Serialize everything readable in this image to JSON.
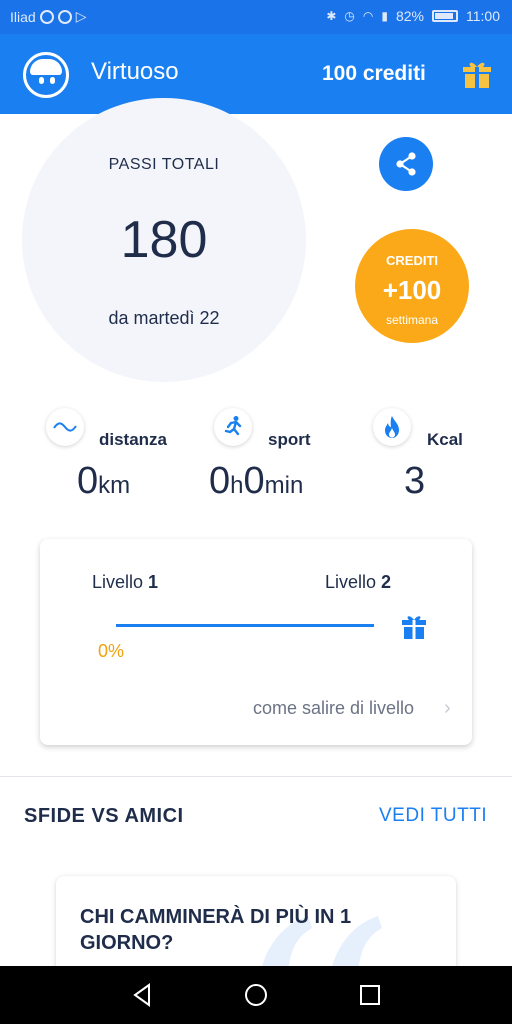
{
  "status_bar": {
    "carrier": "Iliad",
    "battery": "82%",
    "time": "11:00"
  },
  "app_bar": {
    "title": "Virtuoso",
    "credits": "100 crediti",
    "accent": "#1a7ff0"
  },
  "hero": {
    "steps_label": "PASSI TOTALI",
    "steps_value": "180",
    "steps_since": "da martedì 22",
    "credits_badge": {
      "title": "CREDITI",
      "value": "+100",
      "period": "settimana",
      "color": "#fba919"
    }
  },
  "stats": [
    {
      "icon": "wave-icon",
      "label": "distanza",
      "value": "0",
      "unit": "km"
    },
    {
      "icon": "runner-icon",
      "label": "sport",
      "value_h": "0",
      "unit_h": "h",
      "value_m": "0",
      "unit_m": "min"
    },
    {
      "icon": "flame-icon",
      "label": "Kcal",
      "value": "3"
    }
  ],
  "level": {
    "current_label": "Livello",
    "current_num": "1",
    "next_label": "Livello",
    "next_num": "2",
    "progress_percent": 0,
    "progress_text": "0%",
    "how_to_link": "come salire di livello"
  },
  "challenges": {
    "section_title": "SFIDE VS AMICI",
    "see_all": "VEDI TUTTI",
    "card_title": "CHI CAMMINERÀ DI PIÙ IN 1 GIORNO?"
  }
}
